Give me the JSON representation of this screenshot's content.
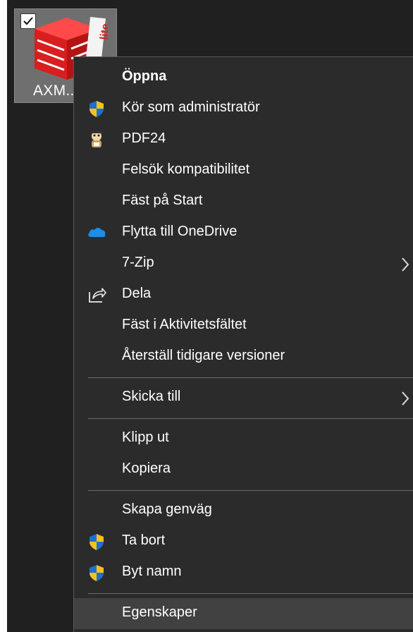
{
  "desktop": {
    "icon_label": "AXM...",
    "icon_checked": true
  },
  "menu": {
    "items": [
      {
        "label": "Öppna",
        "icon": "none",
        "bold": true
      },
      {
        "label": "Kör som administratör",
        "icon": "uac-shield-icon"
      },
      {
        "label": "PDF24",
        "icon": "pdf24-icon"
      },
      {
        "label": "Felsök kompatibilitet",
        "icon": "none"
      },
      {
        "label": "Fäst på Start",
        "icon": "none"
      },
      {
        "label": "Flytta till OneDrive",
        "icon": "onedrive-cloud-icon"
      },
      {
        "label": "7-Zip",
        "icon": "none",
        "submenu": true
      },
      {
        "label": "Dela",
        "icon": "share-icon"
      },
      {
        "label": "Fäst i Aktivitetsfältet",
        "icon": "none"
      },
      {
        "label": "Återställ tidigare versioner",
        "icon": "none"
      },
      {
        "label": "Skicka till",
        "icon": "none",
        "submenu": true
      },
      {
        "label": "Klipp ut",
        "icon": "none"
      },
      {
        "label": "Kopiera",
        "icon": "none"
      },
      {
        "label": "Skapa genväg",
        "icon": "none"
      },
      {
        "label": "Ta bort",
        "icon": "uac-shield-icon"
      },
      {
        "label": "Byt namn",
        "icon": "uac-shield-icon"
      },
      {
        "label": "Egenskaper",
        "icon": "none",
        "highlighted": true
      }
    ]
  },
  "colors": {
    "menu_bg": "#2b2b2b",
    "hover_bg": "#414141",
    "separator": "#6a6a6a",
    "text": "#ffffff",
    "icon_red": "#e02020",
    "shield_blue": "#1f6fd1",
    "shield_yellow": "#f2c31b",
    "onedrive_blue": "#1a8ee8"
  }
}
